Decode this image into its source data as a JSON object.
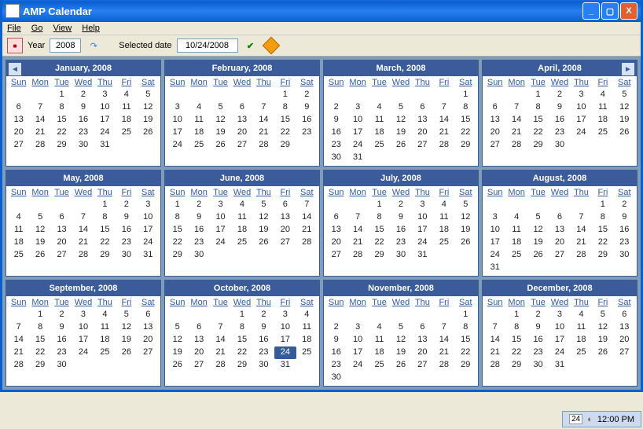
{
  "title": "AMP Calendar",
  "menus": [
    "File",
    "Go",
    "View",
    "Help"
  ],
  "toolbar": {
    "year_label": "Year",
    "year": "2008",
    "selected_label": "Selected date",
    "selected_date": "10/24/2008"
  },
  "dow": [
    "Sun",
    "Mon",
    "Tue",
    "Wed",
    "Thu",
    "Fri",
    "Sat"
  ],
  "months": [
    {
      "name": "January, 2008",
      "start": 2,
      "days": 31,
      "nav": "left"
    },
    {
      "name": "February, 2008",
      "start": 5,
      "days": 29
    },
    {
      "name": "March, 2008",
      "start": 6,
      "days": 31
    },
    {
      "name": "April, 2008",
      "start": 2,
      "days": 30,
      "nav": "right"
    },
    {
      "name": "May, 2008",
      "start": 4,
      "days": 31
    },
    {
      "name": "June, 2008",
      "start": 0,
      "days": 30
    },
    {
      "name": "July, 2008",
      "start": 2,
      "days": 31
    },
    {
      "name": "August, 2008",
      "start": 5,
      "days": 31
    },
    {
      "name": "September, 2008",
      "start": 1,
      "days": 30
    },
    {
      "name": "October, 2008",
      "start": 3,
      "days": 31,
      "selected": 24
    },
    {
      "name": "November, 2008",
      "start": 6,
      "days": 30
    },
    {
      "name": "December, 2008",
      "start": 1,
      "days": 31
    }
  ],
  "tray": {
    "day": "24",
    "time": "12:00 PM"
  }
}
